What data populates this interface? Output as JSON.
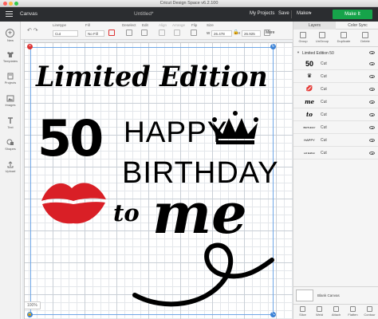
{
  "window": {
    "title": "Cricut Design Space  v6.2.100"
  },
  "header": {
    "section": "Canvas",
    "project_name": "Untitled*",
    "my_projects": "My Projects",
    "save": "Save",
    "machine": "Maker",
    "make_it": "Make It"
  },
  "toolbar": {
    "linetype_label": "Linetype",
    "linetype_value": "Cut",
    "fill_label": "Fill",
    "fill_value": "No Fill",
    "deselect": "Deselect",
    "edit": "Edit",
    "align": "Align",
    "arrange": "Arrange",
    "flip": "Flip",
    "size_label": "Size",
    "size_w": "26.478",
    "size_h": "26.925",
    "size_w_prefix": "W",
    "size_h_prefix": "H",
    "rotate_label": "Rotate",
    "more": "More"
  },
  "leftbar": {
    "items": [
      {
        "label": "New"
      },
      {
        "label": "Templates"
      },
      {
        "label": "Projects"
      },
      {
        "label": "Images"
      },
      {
        "label": "Text"
      },
      {
        "label": "Shapes"
      },
      {
        "label": "Upload"
      }
    ]
  },
  "design": {
    "line1": "Limited Edition",
    "line2": "50",
    "line3": "HAPPY",
    "line4": "BIRTHDAY",
    "line5": "to",
    "line6": "me",
    "lips_color": "#d91f26"
  },
  "canvas": {
    "zoom": "100%"
  },
  "panel": {
    "tabs": [
      "Layers",
      "Color Sync"
    ],
    "actions": [
      "Group",
      "UnGroup",
      "Duplicate",
      "Delete"
    ],
    "group_name": "Limited Edition 50",
    "layers": [
      {
        "thumb": "50",
        "operation": "Cut"
      },
      {
        "thumb": "♛",
        "operation": "Cut"
      },
      {
        "thumb": "💋",
        "operation": "Cut"
      },
      {
        "thumb": "me",
        "operation": "Cut"
      },
      {
        "thumb": "to",
        "operation": "Cut"
      },
      {
        "thumb": "BIRTHDAY",
        "operation": "Cut"
      },
      {
        "thumb": "HAPPY",
        "operation": "Cut"
      },
      {
        "thumb": "Ltd Edition",
        "operation": "Cut"
      }
    ],
    "blank_canvas": "Blank Canvas",
    "bottom_actions": [
      "Slice",
      "Weld",
      "Attach",
      "Flatten",
      "Contour"
    ]
  }
}
